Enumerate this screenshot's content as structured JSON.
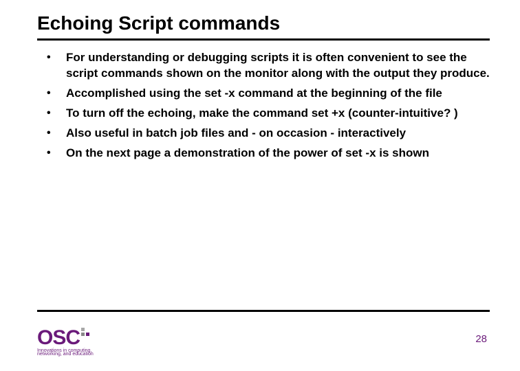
{
  "title": "Echoing Script commands",
  "bullets": [
    "For understanding or debugging scripts it is often convenient to see the script commands shown on the monitor along with the output they produce.",
    "Accomplished using the set -x command at the beginning of the file",
    "To turn off the echoing, make the command set +x (counter-intuitive? )",
    "Also useful in batch job files and - on occasion - interactively",
    "On the next page a demonstration of the power of set -x is shown"
  ],
  "logo": {
    "letters": "OSC",
    "tagline1": "Innovations in computing,",
    "tagline2": "networking, and education"
  },
  "page_number": "28"
}
